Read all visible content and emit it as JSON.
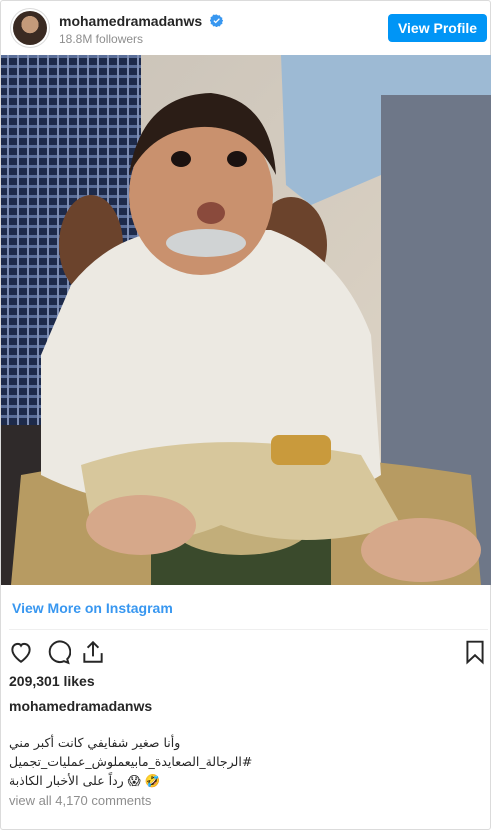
{
  "header": {
    "username": "mohamedramadanws",
    "followers": "18.8M followers",
    "view_profile_label": "View Profile"
  },
  "post": {
    "view_more_label": "View More on Instagram",
    "likes": "209,301 likes",
    "caption_username": "mohamedramadanws",
    "caption_lines": [
      "وأنا صغير شفايفي كانت أكبر مني",
      "#الرجالة_الصعايدة_مابيعملوش_عمليات_تجميل",
      "🤣 😱 رداً على الأخبار الكاذبة"
    ],
    "view_comments_label": "view all 4,170 comments"
  },
  "colors": {
    "accent": "#0095f6",
    "link": "#3897f0",
    "muted": "#8e8e8e"
  },
  "icons": [
    "verified-badge-icon",
    "heart-icon",
    "comment-icon",
    "share-icon",
    "bookmark-icon"
  ]
}
